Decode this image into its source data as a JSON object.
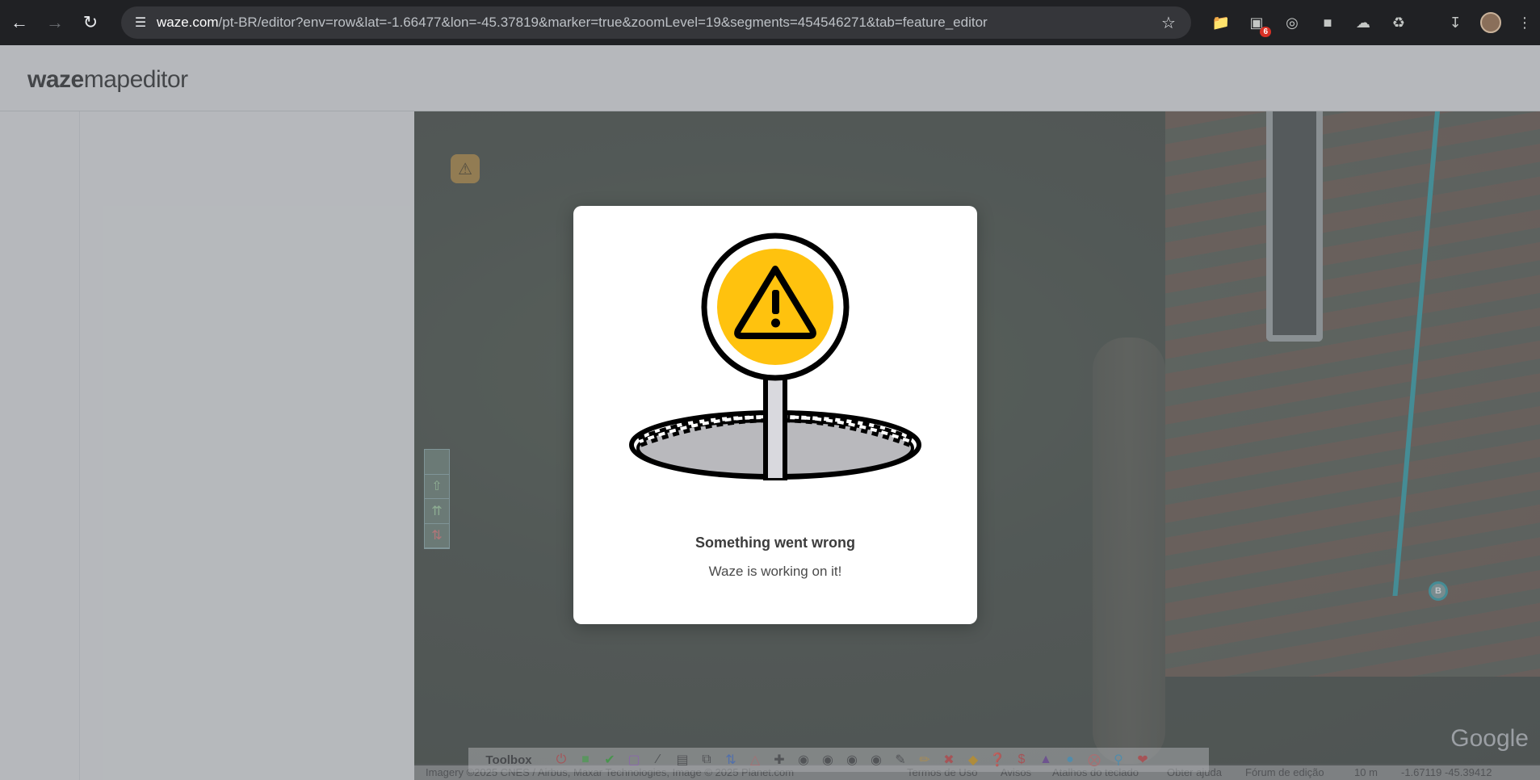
{
  "browser": {
    "url_host": "waze.com",
    "url_rest": "/pt-BR/editor?env=row&lat=-1.66477&lon=-45.37819&marker=true&zoomLevel=19&segments=454546271&tab=feature_editor",
    "extension_badge": "6"
  },
  "app": {
    "logo_bold": "waze",
    "logo_rest": "mapeditor"
  },
  "map": {
    "node_label": "B",
    "attribution_logo": "Google"
  },
  "toolbox": {
    "title": "Toolbox"
  },
  "footer": {
    "imagery": "Imagery ©2025 CNES / Airbus, Maxar Technologies, Image © 2025 Planet.com",
    "terms": "Termos de Uso",
    "notices": "Avisos",
    "shortcuts": "Atalhos do teclado",
    "help": "Obter ajuda",
    "forum": "Fórum de edição",
    "scale": "10 m",
    "coords": "-1.67119 -45.39412"
  },
  "modal": {
    "title": "Something went wrong",
    "subtitle": "Waze is working on it!"
  },
  "colors": {
    "sign_yellow": "#FFC20E",
    "segment": "#1d9aa4"
  }
}
